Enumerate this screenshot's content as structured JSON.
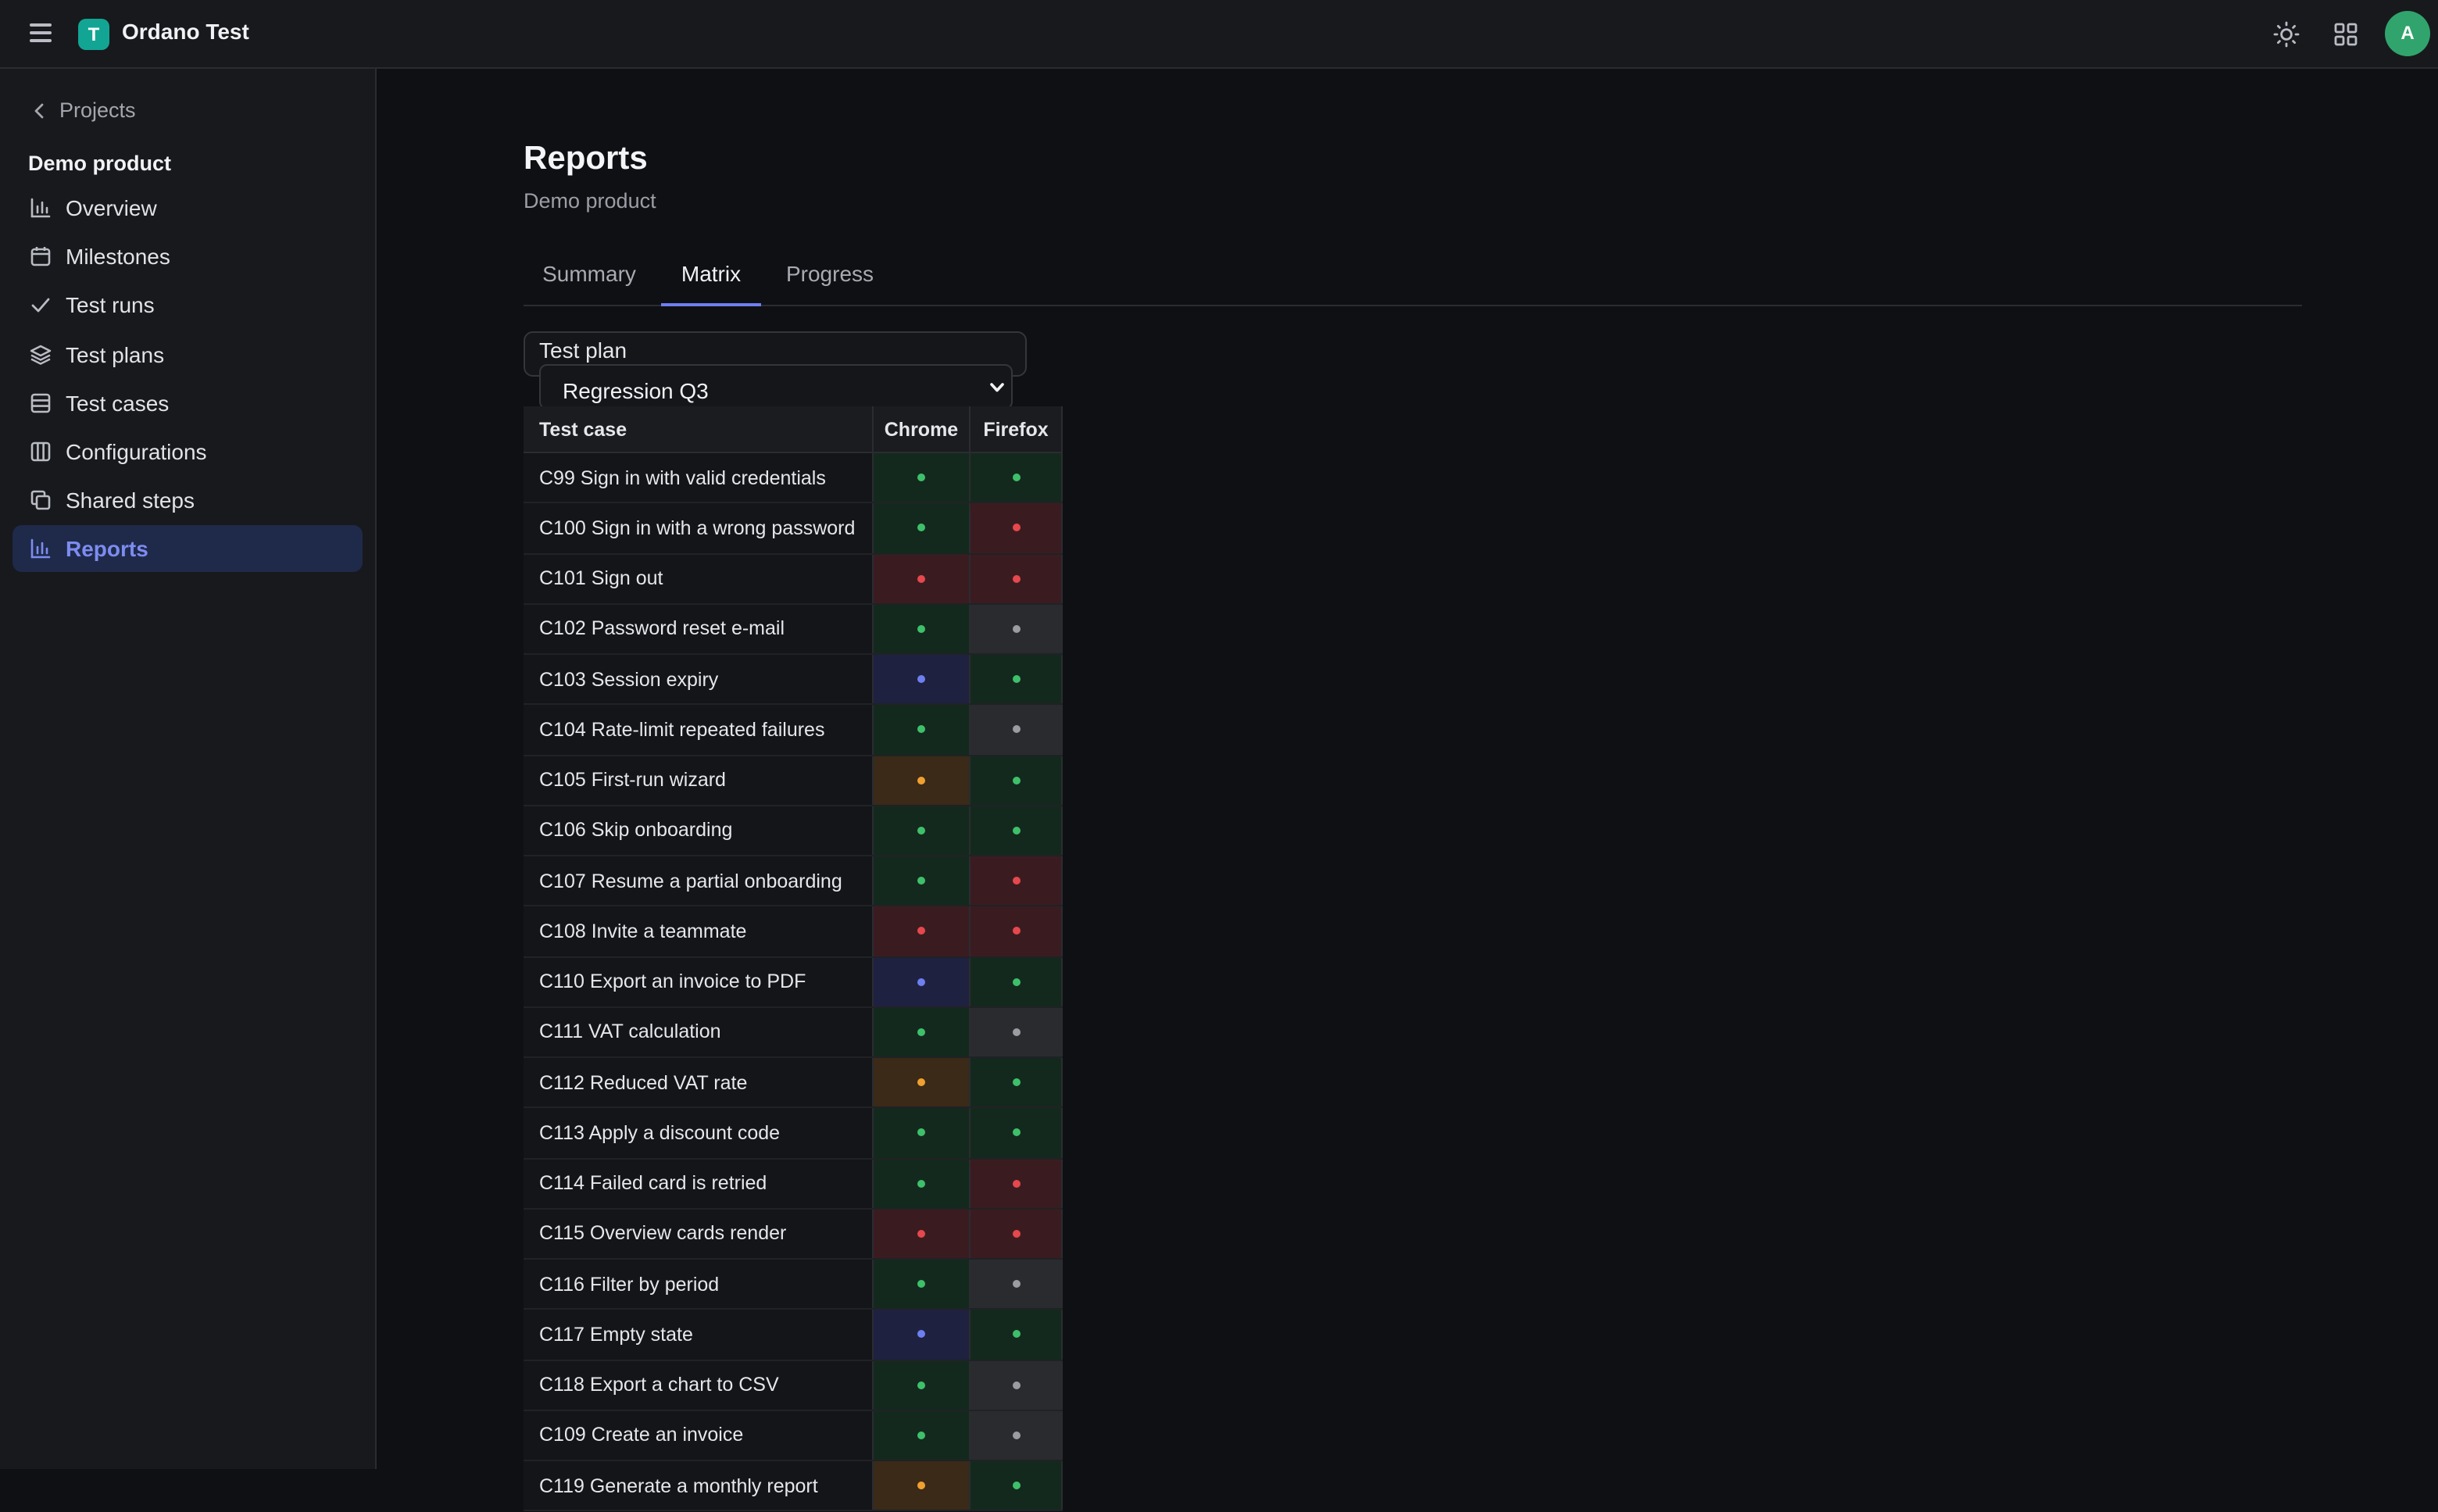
{
  "app": {
    "title": "Ordano Test",
    "logo_letter": "T",
    "avatar_letter": "A"
  },
  "sidebar": {
    "back_label": "Projects",
    "project_name": "Demo product",
    "items": [
      {
        "label": "Overview",
        "icon": "bar-chart-icon"
      },
      {
        "label": "Milestones",
        "icon": "calendar-icon"
      },
      {
        "label": "Test runs",
        "icon": "check-icon"
      },
      {
        "label": "Test plans",
        "icon": "layers-icon"
      },
      {
        "label": "Test cases",
        "icon": "list-icon"
      },
      {
        "label": "Configurations",
        "icon": "columns-icon"
      },
      {
        "label": "Shared steps",
        "icon": "copy-icon"
      },
      {
        "label": "Reports",
        "icon": "bar-chart-icon",
        "active": true
      }
    ]
  },
  "page": {
    "title": "Reports",
    "subtitle": "Demo product",
    "tabs": [
      {
        "label": "Summary"
      },
      {
        "label": "Matrix",
        "active": true
      },
      {
        "label": "Progress"
      }
    ],
    "plan_label": "Test plan",
    "plan_value": "Regression Q3"
  },
  "matrix": {
    "headers": [
      "Test case",
      "Chrome",
      "Firefox"
    ],
    "status_colors": {
      "passed": "#3ec06a",
      "failed": "#e5484d",
      "skipped": "#9a9ca2",
      "blocked": "#6e7ff0",
      "retest": "#f0a030"
    },
    "rows": [
      {
        "name": "C99 Sign in with valid credentials",
        "chrome": "passed",
        "firefox": "passed"
      },
      {
        "name": "C100 Sign in with a wrong password",
        "chrome": "passed",
        "firefox": "failed"
      },
      {
        "name": "C101 Sign out",
        "chrome": "failed",
        "firefox": "failed"
      },
      {
        "name": "C102 Password reset e-mail",
        "chrome": "passed",
        "firefox": "skipped"
      },
      {
        "name": "C103 Session expiry",
        "chrome": "blocked",
        "firefox": "passed"
      },
      {
        "name": "C104 Rate-limit repeated failures",
        "chrome": "passed",
        "firefox": "skipped"
      },
      {
        "name": "C105 First-run wizard",
        "chrome": "retest",
        "firefox": "passed"
      },
      {
        "name": "C106 Skip onboarding",
        "chrome": "passed",
        "firefox": "passed"
      },
      {
        "name": "C107 Resume a partial onboarding",
        "chrome": "passed",
        "firefox": "failed"
      },
      {
        "name": "C108 Invite a teammate",
        "chrome": "failed",
        "firefox": "failed"
      },
      {
        "name": "C110 Export an invoice to PDF",
        "chrome": "blocked",
        "firefox": "passed"
      },
      {
        "name": "C111 VAT calculation",
        "chrome": "passed",
        "firefox": "skipped"
      },
      {
        "name": "C112 Reduced VAT rate",
        "chrome": "retest",
        "firefox": "passed"
      },
      {
        "name": "C113 Apply a discount code",
        "chrome": "passed",
        "firefox": "passed"
      },
      {
        "name": "C114 Failed card is retried",
        "chrome": "passed",
        "firefox": "failed"
      },
      {
        "name": "C115 Overview cards render",
        "chrome": "failed",
        "firefox": "failed"
      },
      {
        "name": "C116 Filter by period",
        "chrome": "passed",
        "firefox": "skipped"
      },
      {
        "name": "C117 Empty state",
        "chrome": "blocked",
        "firefox": "passed"
      },
      {
        "name": "C118 Export a chart to CSV",
        "chrome": "passed",
        "firefox": "skipped"
      },
      {
        "name": "C109 Create an invoice",
        "chrome": "passed",
        "firefox": "skipped"
      },
      {
        "name": "C119 Generate a monthly report",
        "chrome": "retest",
        "firefox": "passed"
      }
    ]
  }
}
